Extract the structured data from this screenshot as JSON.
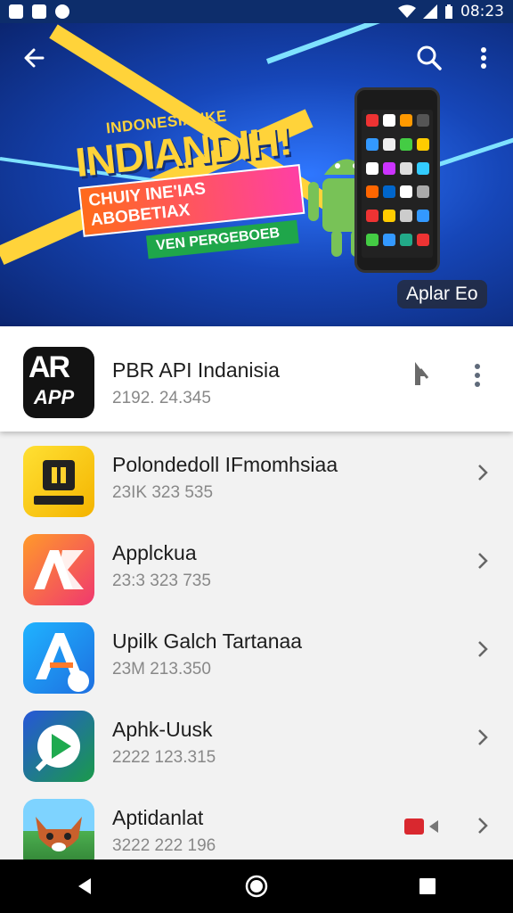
{
  "status_bar": {
    "time": "08:23"
  },
  "banner": {
    "headline_small": "INDONESIANKE",
    "headline": "INDIANDIH!",
    "ribbon": "CHUIY INE'IAS ABOBETIAX",
    "tag": "VEN PERGEBOEB",
    "badge": "Aplar Eo"
  },
  "featured": {
    "title": "PBR API Indanisia",
    "subtitle": "2192. 24.345",
    "icon_text_top": "AR",
    "icon_text_bottom": "APP"
  },
  "apps": [
    {
      "title": "Polondedoll IFmomhsiaa",
      "subtitle": "23IK 323 535",
      "icon": "camera-logo-icon"
    },
    {
      "title": "Applckua",
      "subtitle": "23:3 323 735",
      "icon": "ak-logo-icon"
    },
    {
      "title": "Upilk Galch Tartanaa",
      "subtitle": "23M 213.350",
      "icon": "a-logo-icon"
    },
    {
      "title": "Aphk-Uusk",
      "subtitle": "2222 123.315",
      "icon": "play-logo-icon"
    },
    {
      "title": "Aptidanlat",
      "subtitle": "3222 222 196",
      "icon": "fox-icon"
    }
  ],
  "colors": {
    "banner_blue": "#1646b8",
    "status_bar": "#0d2d6b",
    "accent_yellow": "#ffd33a",
    "accent_green": "#1fa64a"
  }
}
